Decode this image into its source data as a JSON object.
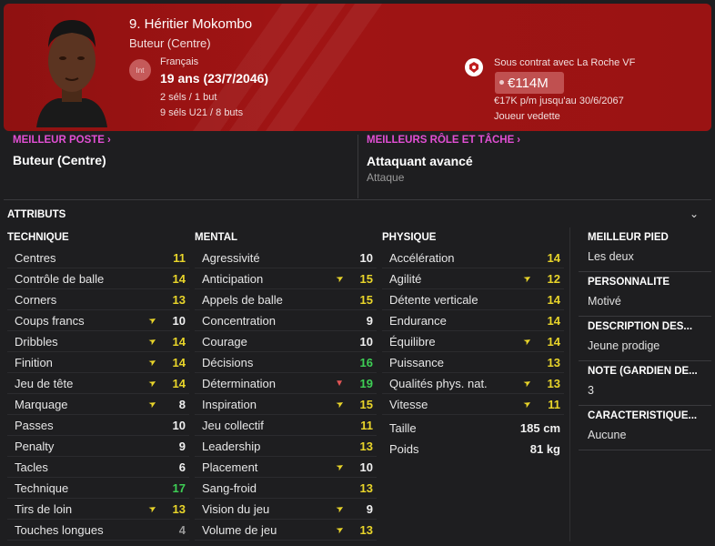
{
  "header": {
    "name": "9. Héritier Mokombo",
    "position": "Buteur (Centre)",
    "flag_label": "Int",
    "nationality": "Français",
    "age": "19 ans (23/7/2046)",
    "caps_senior": "2 séls / 1 but",
    "caps_u21": "9 séls U21 / 8 buts",
    "contract": "Sous contrat avec La Roche VF",
    "value": "€114M",
    "wage": "€17K p/m jusqu'au 30/6/2067",
    "status": "Joueur vedette",
    "colors": {
      "banner": "#9a1313",
      "value_badge": "#c05050"
    }
  },
  "best_position": {
    "label": "MEILLEUR POSTE",
    "value": "Buteur (Centre)"
  },
  "best_role": {
    "label": "MEILLEURS RÔLE ET TÂCHE",
    "value": "Attaquant avancé",
    "sub": "Attaque"
  },
  "attributes": {
    "title": "ATTRIBUTS",
    "technique": {
      "title": "TECHNIQUE",
      "rows": [
        {
          "name": "Centres",
          "value": "11",
          "cls": "v-yellow",
          "arrow": ""
        },
        {
          "name": "Contrôle de balle",
          "value": "14",
          "cls": "v-yellow",
          "arrow": ""
        },
        {
          "name": "Corners",
          "value": "13",
          "cls": "v-yellow",
          "arrow": ""
        },
        {
          "name": "Coups francs",
          "value": "10",
          "cls": "v-white",
          "arrow": "up"
        },
        {
          "name": "Dribbles",
          "value": "14",
          "cls": "v-yellow",
          "arrow": "up"
        },
        {
          "name": "Finition",
          "value": "14",
          "cls": "v-yellow",
          "arrow": "up"
        },
        {
          "name": "Jeu de tête",
          "value": "14",
          "cls": "v-yellow",
          "arrow": "up"
        },
        {
          "name": "Marquage",
          "value": "8",
          "cls": "v-white",
          "arrow": "up"
        },
        {
          "name": "Passes",
          "value": "10",
          "cls": "v-white",
          "arrow": ""
        },
        {
          "name": "Penalty",
          "value": "9",
          "cls": "v-white",
          "arrow": ""
        },
        {
          "name": "Tacles",
          "value": "6",
          "cls": "v-white",
          "arrow": ""
        },
        {
          "name": "Technique",
          "value": "17",
          "cls": "v-green",
          "arrow": ""
        },
        {
          "name": "Tirs de loin",
          "value": "13",
          "cls": "v-yellow",
          "arrow": "up"
        },
        {
          "name": "Touches longues",
          "value": "4",
          "cls": "v-grey",
          "arrow": ""
        }
      ]
    },
    "mental": {
      "title": "MENTAL",
      "rows": [
        {
          "name": "Agressivité",
          "value": "10",
          "cls": "v-white",
          "arrow": ""
        },
        {
          "name": "Anticipation",
          "value": "15",
          "cls": "v-yellow",
          "arrow": "up"
        },
        {
          "name": "Appels de balle",
          "value": "15",
          "cls": "v-yellow",
          "arrow": ""
        },
        {
          "name": "Concentration",
          "value": "9",
          "cls": "v-white",
          "arrow": ""
        },
        {
          "name": "Courage",
          "value": "10",
          "cls": "v-white",
          "arrow": ""
        },
        {
          "name": "Décisions",
          "value": "16",
          "cls": "v-green",
          "arrow": ""
        },
        {
          "name": "Détermination",
          "value": "19",
          "cls": "v-green",
          "arrow": "down"
        },
        {
          "name": "Inspiration",
          "value": "15",
          "cls": "v-yellow",
          "arrow": "up"
        },
        {
          "name": "Jeu collectif",
          "value": "11",
          "cls": "v-yellow",
          "arrow": ""
        },
        {
          "name": "Leadership",
          "value": "13",
          "cls": "v-yellow",
          "arrow": ""
        },
        {
          "name": "Placement",
          "value": "10",
          "cls": "v-white",
          "arrow": "up"
        },
        {
          "name": "Sang-froid",
          "value": "13",
          "cls": "v-yellow",
          "arrow": ""
        },
        {
          "name": "Vision du jeu",
          "value": "9",
          "cls": "v-white",
          "arrow": "up"
        },
        {
          "name": "Volume de jeu",
          "value": "13",
          "cls": "v-yellow",
          "arrow": "up"
        }
      ]
    },
    "physique": {
      "title": "PHYSIQUE",
      "rows": [
        {
          "name": "Accélération",
          "value": "14",
          "cls": "v-yellow",
          "arrow": ""
        },
        {
          "name": "Agilité",
          "value": "12",
          "cls": "v-yellow",
          "arrow": "up"
        },
        {
          "name": "Détente verticale",
          "value": "14",
          "cls": "v-yellow",
          "arrow": ""
        },
        {
          "name": "Endurance",
          "value": "14",
          "cls": "v-yellow",
          "arrow": ""
        },
        {
          "name": "Équilibre",
          "value": "14",
          "cls": "v-yellow",
          "arrow": "up"
        },
        {
          "name": "Puissance",
          "value": "13",
          "cls": "v-yellow",
          "arrow": ""
        },
        {
          "name": "Qualités phys. nat.",
          "value": "13",
          "cls": "v-yellow",
          "arrow": "up"
        },
        {
          "name": "Vitesse",
          "value": "11",
          "cls": "v-yellow",
          "arrow": "up"
        }
      ],
      "height_label": "Taille",
      "height": "185 cm",
      "weight_label": "Poids",
      "weight": "81 kg"
    }
  },
  "side": [
    {
      "title": "MEILLEUR PIED",
      "value": "Les deux"
    },
    {
      "title": "PERSONNALITÉ",
      "value": "Motivé"
    },
    {
      "title": "DESCRIPTION DES...",
      "value": "Jeune prodige"
    },
    {
      "title": "NOTE (GARDIEN DE...",
      "value": "3"
    },
    {
      "title": "CARACTÉRISTIQUE...",
      "value": "Aucune"
    }
  ]
}
